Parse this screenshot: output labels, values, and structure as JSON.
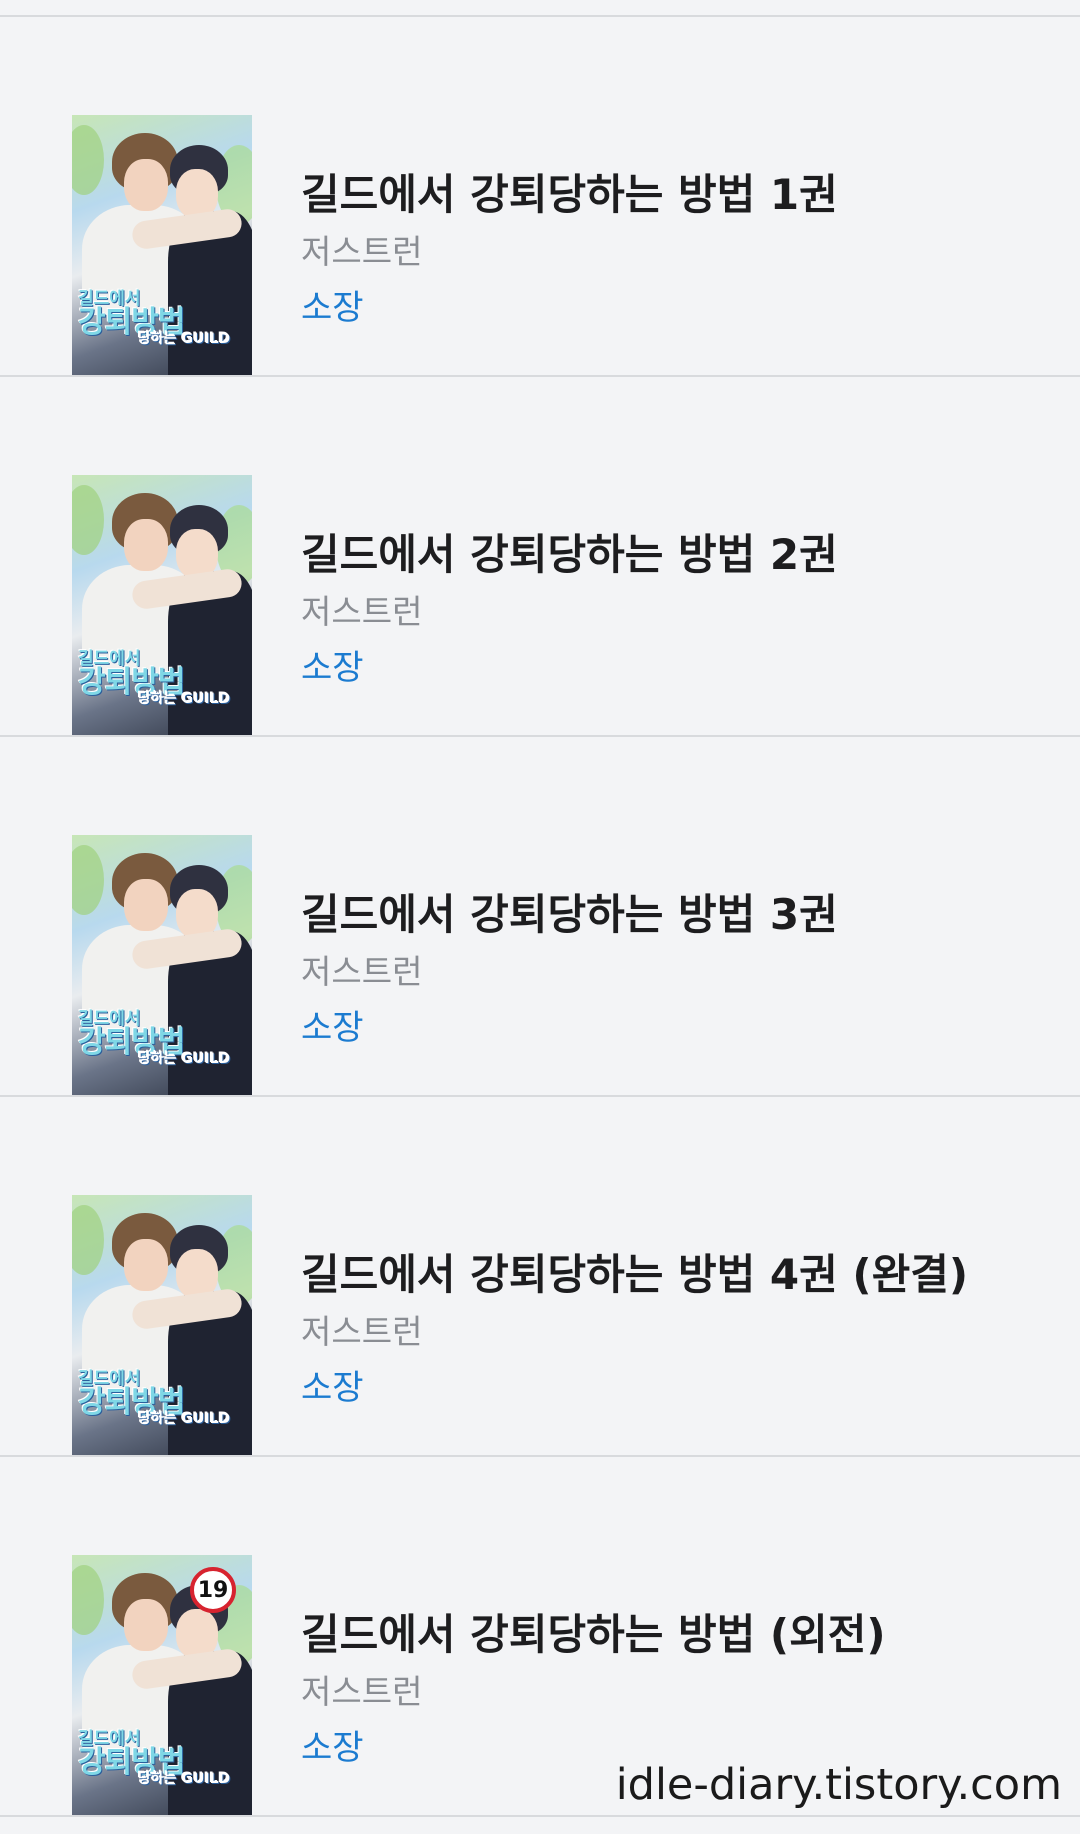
{
  "books": [
    {
      "title": "길드에서 강퇴당하는 방법 1권",
      "author": "저스트런",
      "status": "소장",
      "cover_logo": [
        "길드에서",
        "강퇴방법",
        "당하는 GUILD"
      ],
      "rating_badge": ""
    },
    {
      "title": "길드에서 강퇴당하는 방법 2권",
      "author": "저스트런",
      "status": "소장",
      "cover_logo": [
        "길드에서",
        "강퇴방법",
        "당하는 GUILD"
      ],
      "rating_badge": ""
    },
    {
      "title": "길드에서 강퇴당하는 방법 3권",
      "author": "저스트런",
      "status": "소장",
      "cover_logo": [
        "길드에서",
        "강퇴방법",
        "당하는 GUILD"
      ],
      "rating_badge": ""
    },
    {
      "title": "길드에서 강퇴당하는 방법 4권 (완결)",
      "author": "저스트런",
      "status": "소장",
      "cover_logo": [
        "길드에서",
        "강퇴방법",
        "당하는 GUILD"
      ],
      "rating_badge": ""
    },
    {
      "title": "길드에서 강퇴당하는 방법 (외전)",
      "author": "저스트런",
      "status": "소장",
      "cover_logo": [
        "길드에서",
        "강퇴방법",
        "당하는 GUILD"
      ],
      "rating_badge": "19"
    }
  ],
  "watermark": "idle-diary.tistory.com",
  "colors": {
    "background": "#f3f4f6",
    "divider": "#d8dadd",
    "title": "#1d1d1f",
    "author": "#8a8d93",
    "status": "#1b7bd0",
    "rating_badge_border": "#d7232f"
  }
}
